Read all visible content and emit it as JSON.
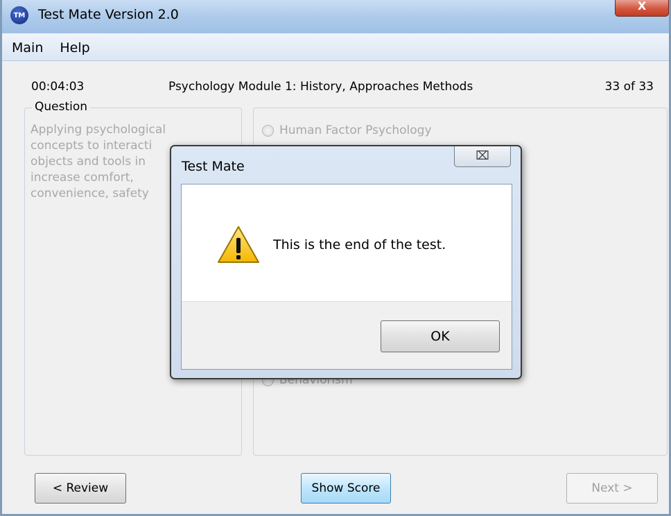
{
  "window": {
    "title": "Test Mate Version 2.0",
    "icon_label": "TM",
    "close_glyph": "X"
  },
  "menu": {
    "items": [
      "Main",
      "Help"
    ]
  },
  "info": {
    "timer": "00:04:03",
    "module_title": "Psychology Module 1: History, Approaches  Methods",
    "progress": "33 of 33"
  },
  "question": {
    "legend": "Question",
    "text_lines": [
      "Applying psychological",
      "concepts to interacti",
      "objects and tools in",
      "increase comfort,",
      "convenience, safety"
    ]
  },
  "answers": {
    "visible": [
      "Human Factor Psychology",
      "Behaviorism"
    ]
  },
  "buttons": {
    "review": "< Review",
    "show_score": "Show Score",
    "next": "Next >"
  },
  "dialog": {
    "title": "Test Mate",
    "close_glyph": "⌧",
    "message": "This is the end of the test.",
    "ok": "OK"
  },
  "colors": {
    "disabled_text": "#a8a8a8",
    "focus_border": "#3c7fb1",
    "warning_yellow": "#f5c400"
  }
}
